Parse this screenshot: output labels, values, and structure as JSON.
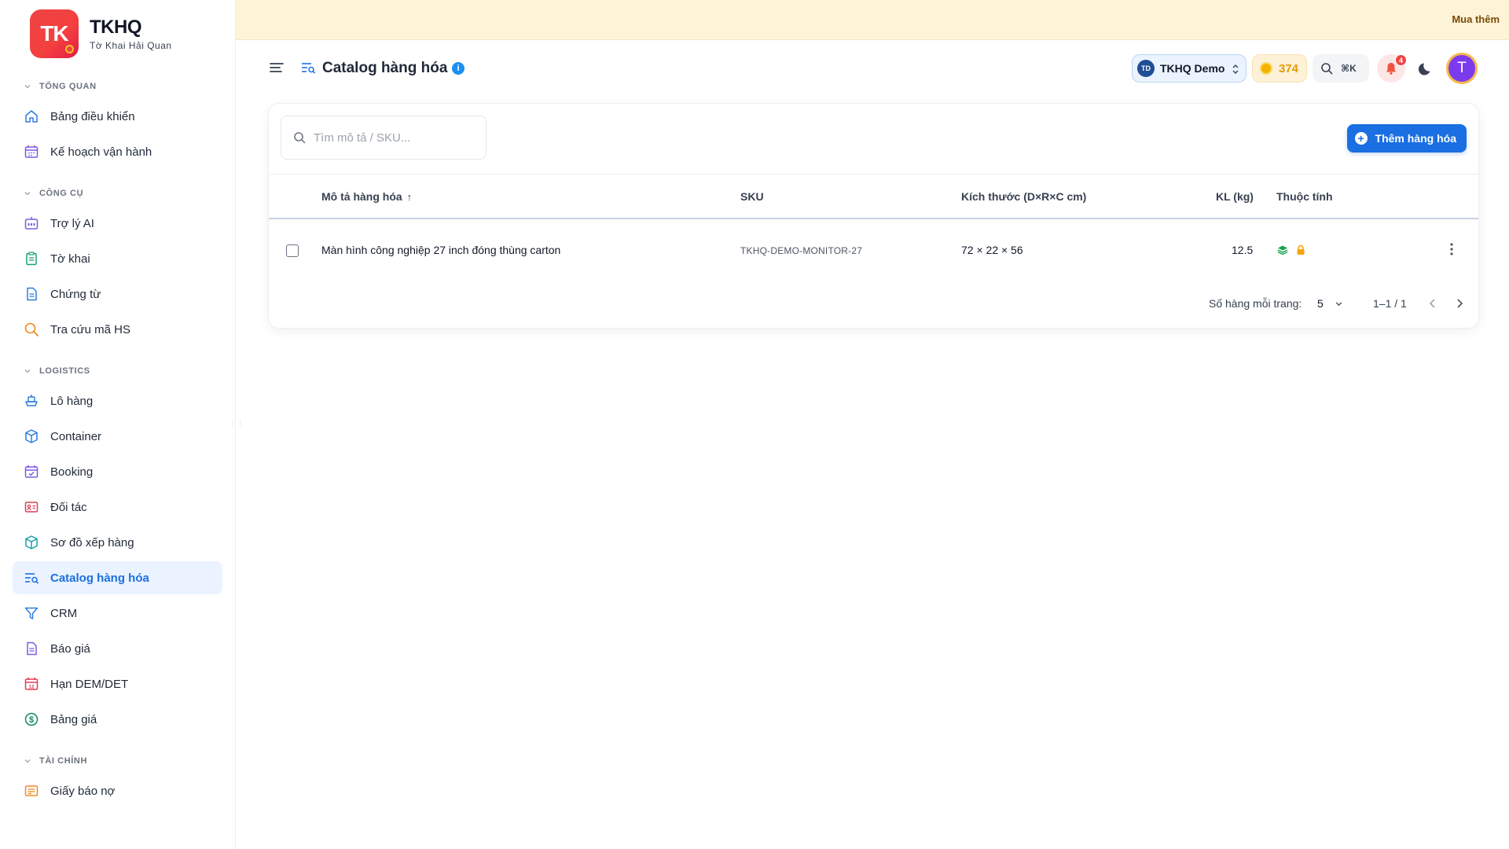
{
  "brand": {
    "logo_text": "TK",
    "title": "TKHQ",
    "subtitle": "Tờ Khai Hải Quan"
  },
  "sidebar": {
    "sections": [
      {
        "label": "TỔNG QUAN",
        "items": [
          {
            "label": "Bảng điều khiển",
            "icon": "home-icon"
          },
          {
            "label": "Kế hoạch vận hành",
            "icon": "calendar-grid-icon"
          }
        ]
      },
      {
        "label": "CÔNG CỤ",
        "items": [
          {
            "label": "Trợ lý AI",
            "icon": "robot-icon"
          },
          {
            "label": "Tờ khai",
            "icon": "clipboard-icon"
          },
          {
            "label": "Chứng từ",
            "icon": "document-icon"
          },
          {
            "label": "Tra cứu mã HS",
            "icon": "search-icon"
          }
        ]
      },
      {
        "label": "LOGISTICS",
        "items": [
          {
            "label": "Lô hàng",
            "icon": "ship-icon"
          },
          {
            "label": "Container",
            "icon": "box-icon"
          },
          {
            "label": "Booking",
            "icon": "calendar-check-icon"
          },
          {
            "label": "Đối tác",
            "icon": "contact-card-icon"
          },
          {
            "label": "Sơ đồ xếp hàng",
            "icon": "cube-icon"
          },
          {
            "label": "Catalog hàng hóa",
            "icon": "list-search-icon",
            "active": true
          },
          {
            "label": "CRM",
            "icon": "funnel-icon"
          },
          {
            "label": "Báo giá",
            "icon": "quote-document-icon"
          },
          {
            "label": "Hạn DEM/DET",
            "icon": "calendar-12-icon"
          },
          {
            "label": "Bảng giá",
            "icon": "dollar-circle-icon"
          }
        ]
      },
      {
        "label": "TÀI CHÍNH",
        "items": [
          {
            "label": "Giấy báo nợ",
            "icon": "receipt-icon"
          }
        ]
      }
    ]
  },
  "banner": {
    "action_label": "Mua thêm"
  },
  "header": {
    "page_title": "Catalog hàng hóa",
    "info_glyph": "i",
    "org": {
      "initials": "TD",
      "name": "TKHQ Demo"
    },
    "credits": "374",
    "search_shortcut": "⌘K",
    "notifications_count": "4",
    "user_initial": "T"
  },
  "catalog": {
    "search_placeholder": "Tìm mô tả / SKU...",
    "add_button_label": "Thêm hàng hóa",
    "columns": {
      "description": "Mô tả hàng hóa",
      "sku": "SKU",
      "dimensions": "Kích thước (D×R×C cm)",
      "weight": "KL (kg)",
      "attributes": "Thuộc tính"
    },
    "sort_arrow": "↑",
    "rows": [
      {
        "description": "Màn hình công nghiệp 27 inch đóng thùng carton",
        "sku": "TKHQ-DEMO-MONITOR-27",
        "dimensions": "72 × 22 × 56",
        "weight": "12.5",
        "attributes": [
          "stack-layers-icon",
          "lock-icon"
        ]
      }
    ],
    "pagination": {
      "rows_per_page_label": "Số hàng mỗi trang:",
      "rows_per_page": "5",
      "range": "1–1 / 1"
    }
  },
  "colors": {
    "accent": "#1a6fe3",
    "brand_red": "#ef4444",
    "banner_bg": "#fdf3d6",
    "active_bg": "#eaf3ff"
  }
}
